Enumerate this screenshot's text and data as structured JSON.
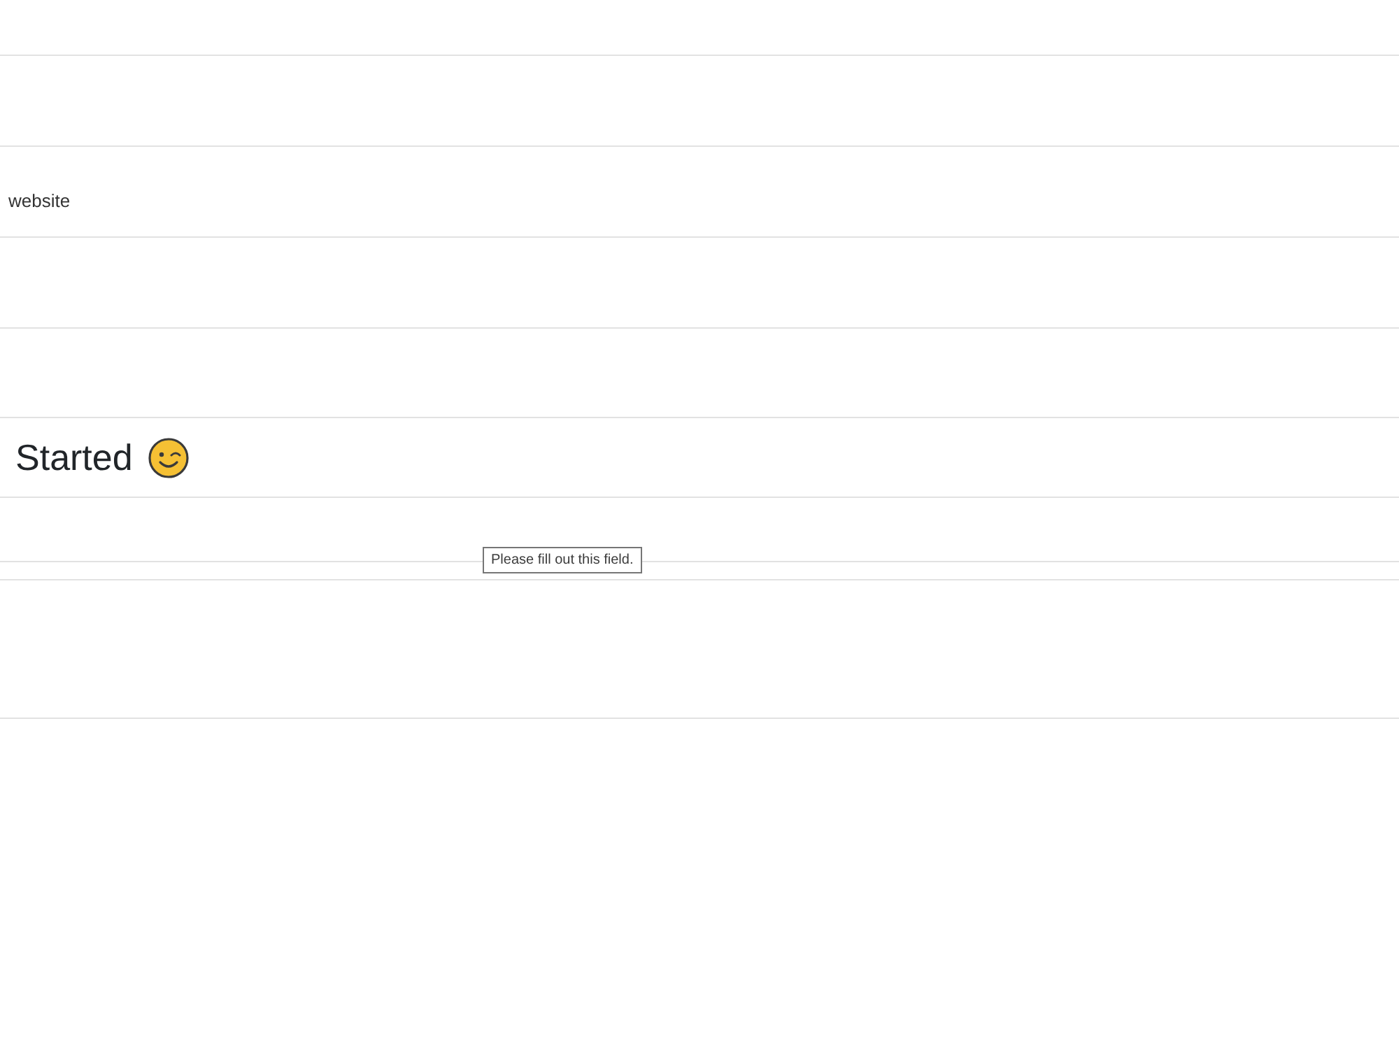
{
  "rows": [
    {
      "kind": "empty"
    },
    {
      "kind": "empty"
    },
    {
      "kind": "text",
      "text": "website"
    },
    {
      "kind": "empty"
    },
    {
      "kind": "empty"
    },
    {
      "kind": "heading",
      "text": "Started"
    },
    {
      "kind": "empty"
    },
    {
      "kind": "empty"
    },
    {
      "kind": "empty"
    }
  ],
  "validation_tooltip": {
    "text": "Please fill out this field."
  }
}
